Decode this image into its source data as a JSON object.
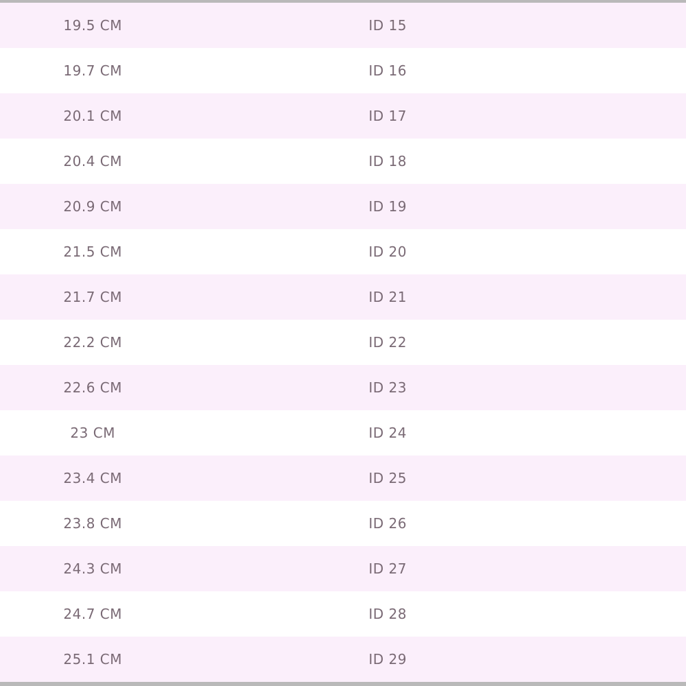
{
  "size_table": {
    "rows": [
      {
        "cm": "19.5 CM",
        "id": "ID 15"
      },
      {
        "cm": "19.7 CM",
        "id": "ID 16"
      },
      {
        "cm": "20.1 CM",
        "id": "ID 17"
      },
      {
        "cm": "20.4 CM",
        "id": "ID 18"
      },
      {
        "cm": "20.9 CM",
        "id": "ID 19"
      },
      {
        "cm": "21.5 CM",
        "id": "ID 20"
      },
      {
        "cm": "21.7 CM",
        "id": "ID 21"
      },
      {
        "cm": "22.2 CM",
        "id": "ID 22"
      },
      {
        "cm": "22.6 CM",
        "id": "ID 23"
      },
      {
        "cm": "23 CM",
        "id": "ID 24"
      },
      {
        "cm": "23.4 CM",
        "id": "ID 25"
      },
      {
        "cm": "23.8 CM",
        "id": "ID 26"
      },
      {
        "cm": "24.3 CM",
        "id": "ID 27"
      },
      {
        "cm": "24.7 CM",
        "id": "ID 28"
      },
      {
        "cm": "25.1 CM",
        "id": "ID 29"
      }
    ]
  },
  "colors": {
    "stripe": "#fbeffb",
    "text": "#7a6a75",
    "border": "#b9b9b9"
  }
}
